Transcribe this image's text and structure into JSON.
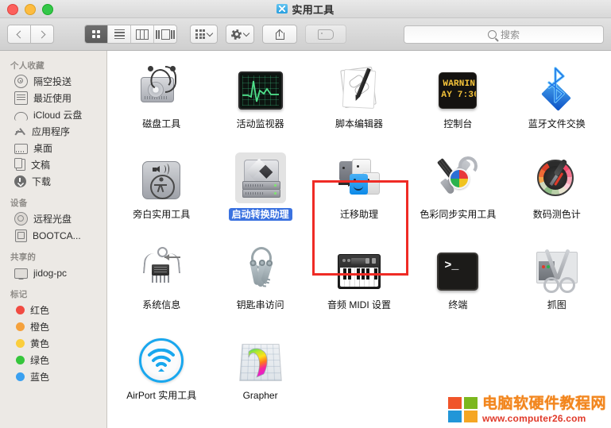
{
  "window": {
    "title": "实用工具",
    "title_icon": "blue-folder-tool-icon",
    "traffic_lights": [
      "close-button",
      "minimize-button",
      "zoom-button"
    ]
  },
  "toolbar": {
    "back_label": "‹",
    "forward_label": "›",
    "view_modes": [
      {
        "name": "icon-view",
        "active": true
      },
      {
        "name": "list-view",
        "active": false
      },
      {
        "name": "column-view",
        "active": false
      },
      {
        "name": "coverflow-view",
        "active": false
      }
    ],
    "arrange_label": "",
    "action_label": "",
    "share_label": "",
    "tag_label": "",
    "tag_disabled": true
  },
  "search": {
    "placeholder": "搜索",
    "value": "",
    "icon": "search-icon"
  },
  "sidebar": {
    "sections": [
      {
        "heading": "个人收藏",
        "items": [
          {
            "label": "隔空投送",
            "icon": "airdrop-icon"
          },
          {
            "label": "最近使用",
            "icon": "recents-icon"
          },
          {
            "label": "iCloud 云盘",
            "icon": "icloud-icon"
          },
          {
            "label": "应用程序",
            "icon": "applications-icon"
          },
          {
            "label": "桌面",
            "icon": "desktop-icon"
          },
          {
            "label": "文稿",
            "icon": "documents-icon"
          },
          {
            "label": "下载",
            "icon": "downloads-icon"
          }
        ]
      },
      {
        "heading": "设备",
        "items": [
          {
            "label": "远程光盘",
            "icon": "remote-disc-icon"
          },
          {
            "label": "BOOTCA...",
            "icon": "hard-drive-icon"
          }
        ]
      },
      {
        "heading": "共享的",
        "items": [
          {
            "label": "jidog-pc",
            "icon": "shared-computer-icon"
          }
        ]
      },
      {
        "heading": "标记",
        "items": [
          {
            "label": "红色",
            "icon": "tag-dot-icon",
            "color": "#f14b42"
          },
          {
            "label": "橙色",
            "icon": "tag-dot-icon",
            "color": "#f5a13c"
          },
          {
            "label": "黄色",
            "icon": "tag-dot-icon",
            "color": "#fbce3c"
          },
          {
            "label": "绿色",
            "icon": "tag-dot-icon",
            "color": "#36c63c"
          },
          {
            "label": "蓝色",
            "icon": "tag-dot-icon",
            "color": "#3aa0f0"
          }
        ]
      }
    ]
  },
  "content": {
    "items": [
      {
        "label": "磁盘工具",
        "icon": "disk-utility-icon",
        "selected": false
      },
      {
        "label": "活动监视器",
        "icon": "activity-monitor-icon",
        "selected": false
      },
      {
        "label": "脚本编辑器",
        "icon": "script-editor-icon",
        "selected": false
      },
      {
        "label": "控制台",
        "icon": "console-icon",
        "selected": false
      },
      {
        "label": "蓝牙文件交换",
        "icon": "bluetooth-exchange-icon",
        "selected": false
      },
      {
        "label": "旁白实用工具",
        "icon": "voiceover-utility-icon",
        "selected": false
      },
      {
        "label": "启动转换助理",
        "icon": "boot-camp-assistant-icon",
        "selected": true
      },
      {
        "label": "迁移助理",
        "icon": "migration-assistant-icon",
        "selected": false
      },
      {
        "label": "色彩同步实用工具",
        "icon": "colorsync-utility-icon",
        "selected": false
      },
      {
        "label": "数码测色计",
        "icon": "digital-color-meter-icon",
        "selected": false
      },
      {
        "label": "系统信息",
        "icon": "system-information-icon",
        "selected": false
      },
      {
        "label": "钥匙串访问",
        "icon": "keychain-access-icon",
        "selected": false
      },
      {
        "label": "音频 MIDI 设置",
        "icon": "audio-midi-setup-icon",
        "selected": false
      },
      {
        "label": "终端",
        "icon": "terminal-icon",
        "selected": false
      },
      {
        "label": "抓图",
        "icon": "grab-icon",
        "selected": false
      },
      {
        "label": "AirPort 实用工具",
        "icon": "airport-utility-icon",
        "selected": false
      },
      {
        "label": "Grapher",
        "icon": "grapher-icon",
        "selected": false
      }
    ],
    "console_icon_text": {
      "line1": "WARNIN",
      "line2": "AY 7:36"
    },
    "terminal_icon_text": ">_",
    "annotation": {
      "shape": "rectangle",
      "color": "#ef2b25",
      "around": "启动转换助理"
    }
  },
  "watermark": {
    "title": "电脑软硬件教程网",
    "url": "www.computer26.com",
    "logo_colors": [
      "#f0552a",
      "#7cb71e",
      "#2196d8",
      "#f5a623"
    ]
  }
}
